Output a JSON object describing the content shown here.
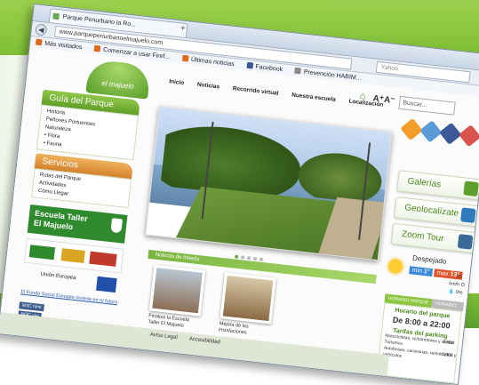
{
  "browser": {
    "tab_title": "Parque Periurbano la Ro...",
    "new_tab": "+",
    "url": "www.parqueperiurbanoelmajuelo.com",
    "search_placeholder": "Yahoo",
    "back": "◀",
    "bookmarks": [
      {
        "label": "Más visitados",
        "color": "#e06a1b"
      },
      {
        "label": "Comenzar a usar Firef...",
        "color": "#e06a1b"
      },
      {
        "label": "Últimas noticias",
        "color": "#e06a1b"
      },
      {
        "label": "Facebook",
        "color": "#3b5998"
      },
      {
        "label": "Prevención HABIM...",
        "color": "#888888"
      }
    ]
  },
  "site": {
    "logo_text": "el majuelo",
    "menu": [
      "Inicio",
      "Noticias",
      "Recorrido virtual",
      "Nuestra escuela",
      "Localización"
    ],
    "font_size_label": "A⁺A⁻",
    "search_placeholder": "Buscar...",
    "guia": {
      "title": "Guía del Parque",
      "items": [
        "Historia",
        "Peñones Portuenses",
        "Naturaleza",
        "• Flora",
        "• Fauna"
      ]
    },
    "servicios": {
      "title": "Servicios",
      "items": [
        "Rutas del Parque",
        "Actividades",
        "Cómo Llegar"
      ]
    },
    "escuela": {
      "line1": "Escuela Taller",
      "line2": "El Majuelo"
    },
    "fse": {
      "title": "Unión Europea",
      "link": "El Fondo Social Europeo invierte en tu futuro"
    },
    "w3c": [
      "W3C html",
      "W3C css"
    ],
    "noticias_title": "Noticias de Interés",
    "news": [
      {
        "caption": "Finaliza la Escuela Taller El Majuelo"
      },
      {
        "caption": "Mejora de las instalaciones"
      }
    ],
    "right_buttons": [
      {
        "label": "Galerías",
        "color": "#5aa02a"
      },
      {
        "label": "Geolocalízate",
        "color": "#2f7ab8"
      },
      {
        "label": "Zoom Tour",
        "color": "#3a6a98"
      }
    ],
    "weather": {
      "city": "Despejado",
      "min_label": "min",
      "max_label": "max",
      "min": "1°",
      "max": "13°",
      "wind": "→ 10 km/h O",
      "humidity": "💧 0%"
    },
    "hours_tabs": [
      "HORARIO PARQUE",
      "HORARIO..."
    ],
    "hours": {
      "title": "Horario del parque",
      "time": "De 8:00 a 22:00",
      "tarifas_title": "Tarifas del parking",
      "rows": [
        {
          "label": "Motocicletas, ciclomotores y similar",
          "price": "0,60€"
        },
        {
          "label": "Turismos",
          "price": ""
        },
        {
          "label": "Autobuses, caravanas, remolcados y vehículos",
          "price": "0,90€"
        }
      ]
    },
    "footer_links": [
      "Aviso Legal",
      "Accesibilidad"
    ]
  }
}
